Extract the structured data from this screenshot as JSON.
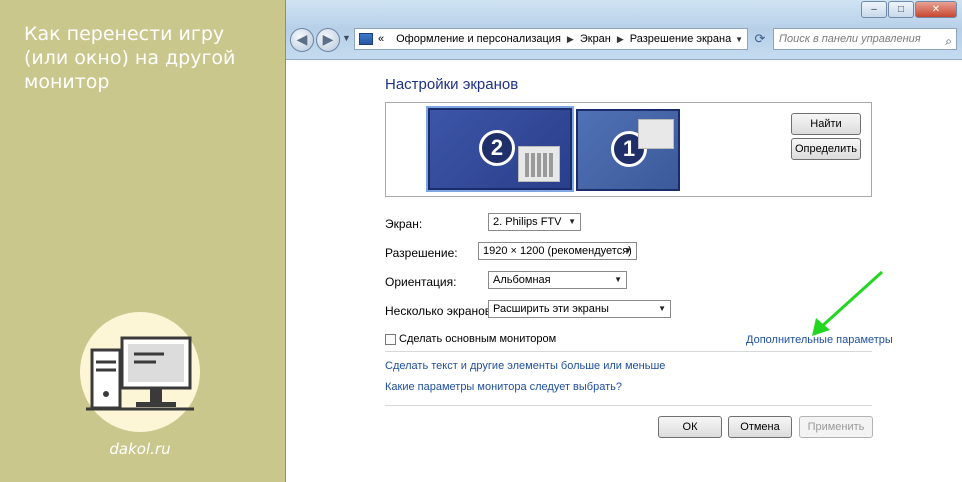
{
  "banner": {
    "title": "Как перенести игру (или окно) на другой монитор",
    "site": "dakol.ru",
    "logo_icon": "computer-icon"
  },
  "window": {
    "controls": {
      "minimize": "–",
      "maximize": "□",
      "close": "✕"
    },
    "breadcrumb": {
      "prefix": "«",
      "items": [
        "Оформление и персонализация",
        "Экран",
        "Разрешение экрана"
      ]
    },
    "search_placeholder": "Поиск в панели управления",
    "heading": "Настройки экранов",
    "preview": {
      "monitor_2": "2",
      "monitor_1": "1",
      "find_button": "Найти",
      "identify_button": "Определить"
    },
    "fields": {
      "screen_label": "Экран:",
      "screen_value": "2. Philips FTV",
      "resolution_label": "Разрешение:",
      "resolution_value": "1920 × 1200 (рекомендуется)",
      "orientation_label": "Ориентация:",
      "orientation_value": "Альбомная",
      "multiple_label": "Несколько экранов:",
      "multiple_value": "Расширить эти экраны"
    },
    "primary_checkbox_label": "Сделать основным монитором",
    "advanced_link": "Дополнительные параметры",
    "links": [
      "Сделать текст и другие элементы больше или меньше",
      "Какие параметры монитора следует выбрать?"
    ],
    "buttons": {
      "ok": "ОК",
      "cancel": "Отмена",
      "apply": "Применить"
    }
  },
  "colors": {
    "banner": "#c9c78c",
    "heading": "#1e3287",
    "link": "#1f4f9c",
    "arrow": "#22d622"
  }
}
